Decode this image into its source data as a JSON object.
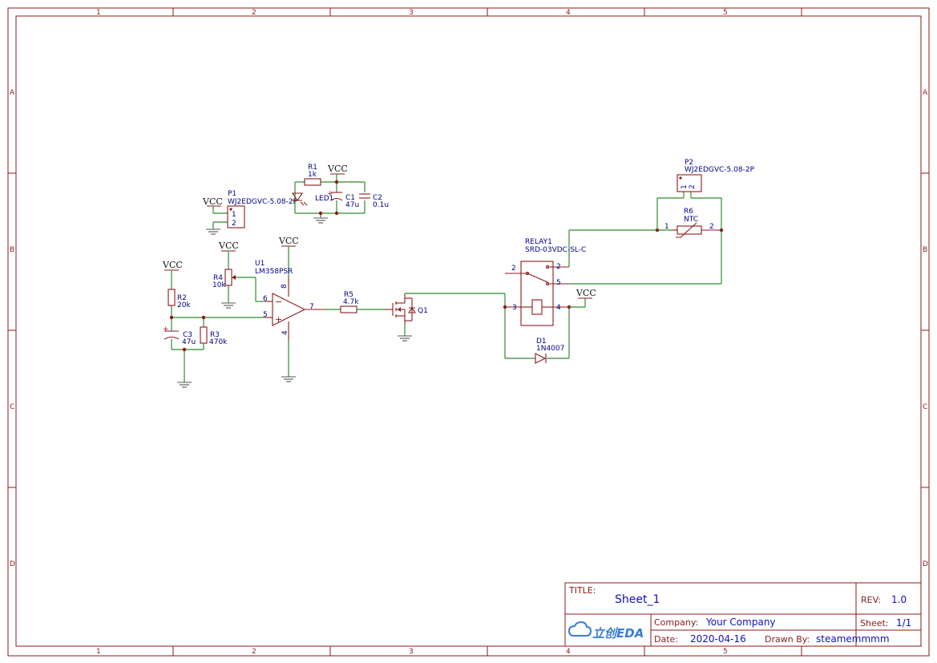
{
  "border": {
    "columns": [
      "1",
      "2",
      "3",
      "4",
      "5"
    ],
    "rows": [
      "A",
      "B",
      "C",
      "D"
    ]
  },
  "title_block": {
    "title_label": "TITLE:",
    "title": "Sheet_1",
    "rev_label": "REV:",
    "rev": "1.0",
    "company_label": "Company:",
    "company": "Your Company",
    "sheet_label": "Sheet:",
    "sheet": "1/1",
    "date_label": "Date:",
    "date": "2020-04-16",
    "drawn_label": "Drawn By:",
    "drawn_by": "steamemmmm",
    "logo_text": "立创EDA"
  },
  "power": {
    "vcc": "VCC"
  },
  "components": {
    "r1": {
      "ref": "R1",
      "value": "1k"
    },
    "r2": {
      "ref": "R2",
      "value": "20k"
    },
    "r3": {
      "ref": "R3",
      "value": "470k"
    },
    "r4": {
      "ref": "R4",
      "value": "10k"
    },
    "r5": {
      "ref": "R5",
      "value": "4.7k"
    },
    "r6": {
      "ref": "R6",
      "value": "NTC"
    },
    "c1": {
      "ref": "C1",
      "value": "47u"
    },
    "c2": {
      "ref": "C2",
      "value": "0.1u"
    },
    "c3": {
      "ref": "C3",
      "value": "47u"
    },
    "led": {
      "ref": "LED1"
    },
    "p1": {
      "ref": "P1",
      "value": "WJ2EDGVC-5.08-2P"
    },
    "p2": {
      "ref": "P2",
      "value": "WJ2EDGVC-5.08-2P"
    },
    "u1": {
      "ref": "U1",
      "value": "LM358PSR"
    },
    "q1": {
      "ref": "Q1"
    },
    "relay": {
      "ref": "RELAY1",
      "value": "SRD-03VDC-SL-C"
    },
    "d1": {
      "ref": "D1",
      "value": "1N4007"
    }
  },
  "pins": {
    "p1_1": "1",
    "p1_2": "2",
    "p2_1": "1",
    "p2_2": "2",
    "u1_6": "6",
    "u1_5": "5",
    "u1_7": "7",
    "u1_8": "8",
    "u1_4": "4",
    "r6_1": "1",
    "r6_2": "2",
    "relay_2a": "2",
    "relay_2b": "2",
    "relay_5": "5",
    "relay_3": "3",
    "relay_4": "4"
  }
}
